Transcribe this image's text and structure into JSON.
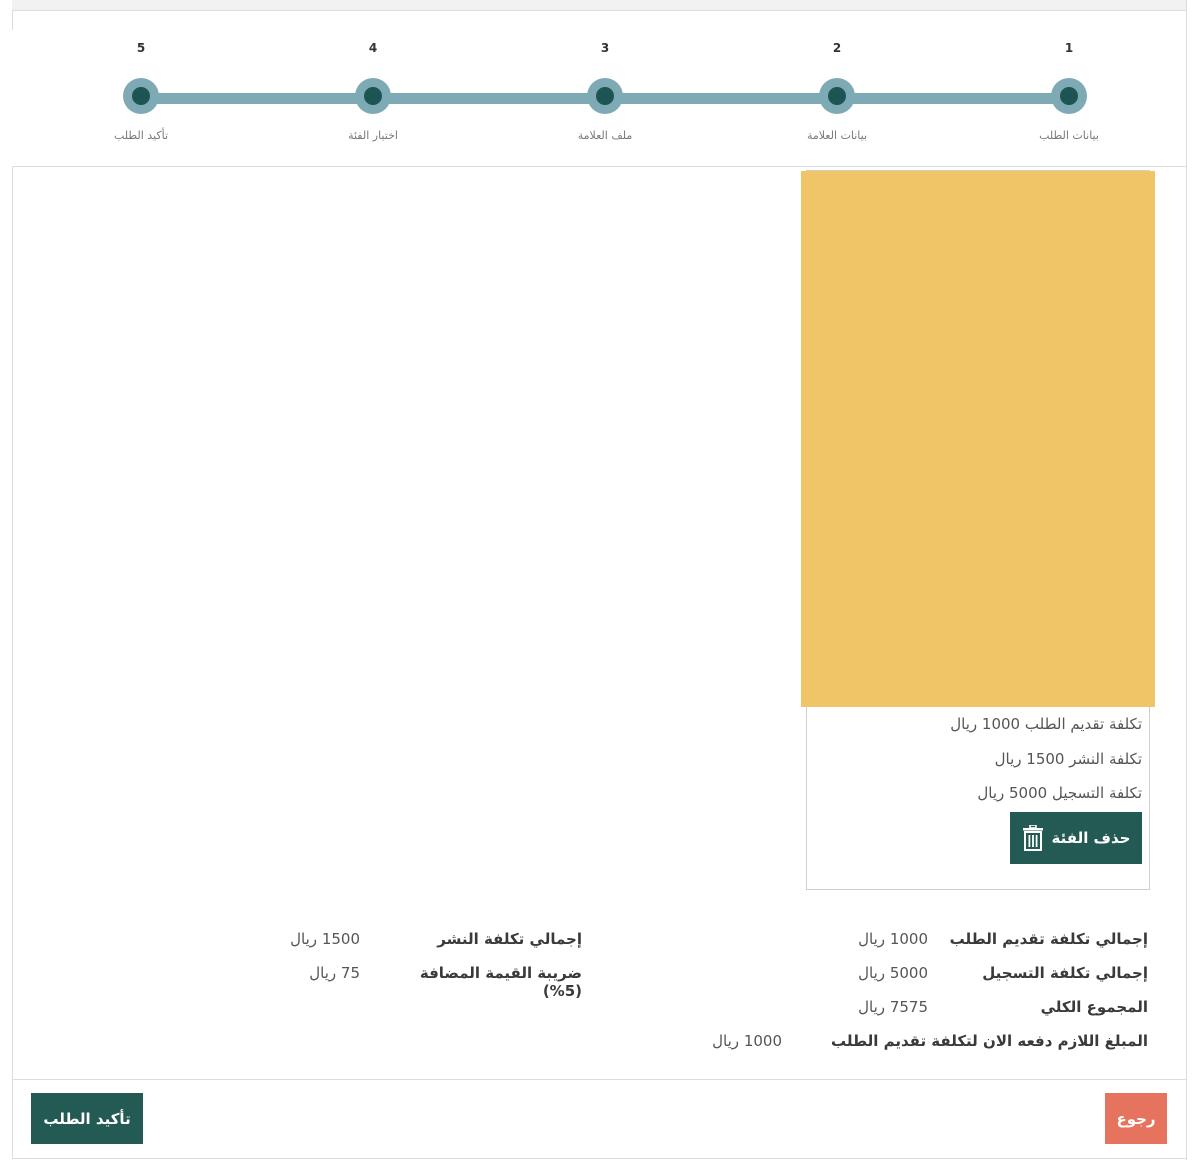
{
  "stepper": {
    "steps": [
      {
        "number": "1",
        "label": "بيانات الطلب"
      },
      {
        "number": "2",
        "label": "بيانات العلامة"
      },
      {
        "number": "3",
        "label": "ملف العلامة"
      },
      {
        "number": "4",
        "label": "اختيار الفئة"
      },
      {
        "number": "5",
        "label": "تأكيد الطلب"
      }
    ]
  },
  "category_card": {
    "fees": [
      "تكلفة تقديم الطلب 1000 ريال",
      "تكلفة النشر 1500 ريال",
      "تكلفة التسجيل 5000 ريال"
    ],
    "delete_label": "حذف الفئة"
  },
  "summary": {
    "request_total_label": "إجمالي تكلفة تقديم الطلب",
    "request_total_value": "1000 ريال",
    "registration_total_label": "إجمالي تكلفة التسجيل",
    "registration_total_value": "5000 ريال",
    "grand_total_label": "المجموع الكلي",
    "grand_total_value": "7575 ريال",
    "due_now_label": "المبلغ اللازم دفعه الان لتكلفة تقديم الطلب",
    "due_now_value": "1000 ريال",
    "publish_total_label": "إجمالي تكلفة النشر",
    "publish_total_value": "1500 ريال",
    "vat_label": "ضريبة القيمة المضافة (5%)",
    "vat_value": "75 ريال"
  },
  "footer": {
    "confirm_label": "تأكيد الطلب",
    "back_label": "رجوع"
  },
  "colors": {
    "primary": "#245a54",
    "step_track": "#7eaab5",
    "back_button": "#e5735e",
    "placeholder_image": "#f0c567"
  }
}
